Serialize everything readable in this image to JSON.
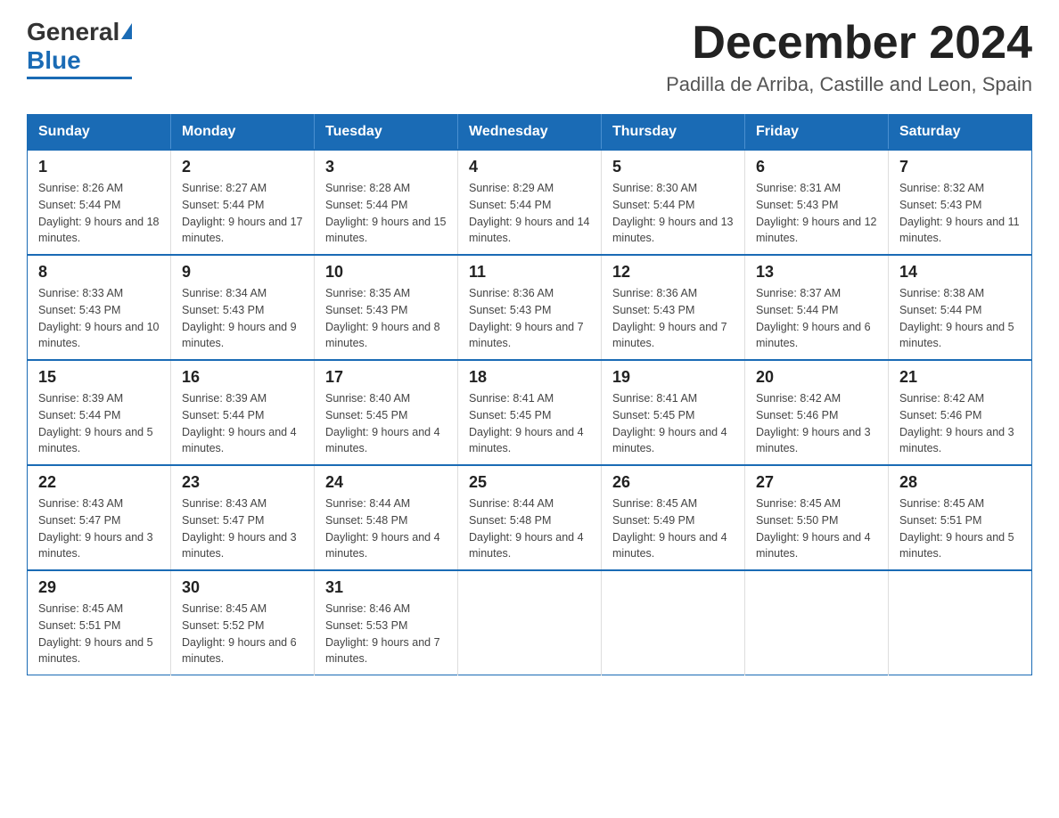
{
  "header": {
    "logo": {
      "general": "General",
      "blue": "Blue"
    },
    "title": "December 2024",
    "location": "Padilla de Arriba, Castille and Leon, Spain"
  },
  "days_of_week": [
    "Sunday",
    "Monday",
    "Tuesday",
    "Wednesday",
    "Thursday",
    "Friday",
    "Saturday"
  ],
  "weeks": [
    [
      {
        "day": "1",
        "sunrise": "Sunrise: 8:26 AM",
        "sunset": "Sunset: 5:44 PM",
        "daylight": "Daylight: 9 hours and 18 minutes."
      },
      {
        "day": "2",
        "sunrise": "Sunrise: 8:27 AM",
        "sunset": "Sunset: 5:44 PM",
        "daylight": "Daylight: 9 hours and 17 minutes."
      },
      {
        "day": "3",
        "sunrise": "Sunrise: 8:28 AM",
        "sunset": "Sunset: 5:44 PM",
        "daylight": "Daylight: 9 hours and 15 minutes."
      },
      {
        "day": "4",
        "sunrise": "Sunrise: 8:29 AM",
        "sunset": "Sunset: 5:44 PM",
        "daylight": "Daylight: 9 hours and 14 minutes."
      },
      {
        "day": "5",
        "sunrise": "Sunrise: 8:30 AM",
        "sunset": "Sunset: 5:44 PM",
        "daylight": "Daylight: 9 hours and 13 minutes."
      },
      {
        "day": "6",
        "sunrise": "Sunrise: 8:31 AM",
        "sunset": "Sunset: 5:43 PM",
        "daylight": "Daylight: 9 hours and 12 minutes."
      },
      {
        "day": "7",
        "sunrise": "Sunrise: 8:32 AM",
        "sunset": "Sunset: 5:43 PM",
        "daylight": "Daylight: 9 hours and 11 minutes."
      }
    ],
    [
      {
        "day": "8",
        "sunrise": "Sunrise: 8:33 AM",
        "sunset": "Sunset: 5:43 PM",
        "daylight": "Daylight: 9 hours and 10 minutes."
      },
      {
        "day": "9",
        "sunrise": "Sunrise: 8:34 AM",
        "sunset": "Sunset: 5:43 PM",
        "daylight": "Daylight: 9 hours and 9 minutes."
      },
      {
        "day": "10",
        "sunrise": "Sunrise: 8:35 AM",
        "sunset": "Sunset: 5:43 PM",
        "daylight": "Daylight: 9 hours and 8 minutes."
      },
      {
        "day": "11",
        "sunrise": "Sunrise: 8:36 AM",
        "sunset": "Sunset: 5:43 PM",
        "daylight": "Daylight: 9 hours and 7 minutes."
      },
      {
        "day": "12",
        "sunrise": "Sunrise: 8:36 AM",
        "sunset": "Sunset: 5:43 PM",
        "daylight": "Daylight: 9 hours and 7 minutes."
      },
      {
        "day": "13",
        "sunrise": "Sunrise: 8:37 AM",
        "sunset": "Sunset: 5:44 PM",
        "daylight": "Daylight: 9 hours and 6 minutes."
      },
      {
        "day": "14",
        "sunrise": "Sunrise: 8:38 AM",
        "sunset": "Sunset: 5:44 PM",
        "daylight": "Daylight: 9 hours and 5 minutes."
      }
    ],
    [
      {
        "day": "15",
        "sunrise": "Sunrise: 8:39 AM",
        "sunset": "Sunset: 5:44 PM",
        "daylight": "Daylight: 9 hours and 5 minutes."
      },
      {
        "day": "16",
        "sunrise": "Sunrise: 8:39 AM",
        "sunset": "Sunset: 5:44 PM",
        "daylight": "Daylight: 9 hours and 4 minutes."
      },
      {
        "day": "17",
        "sunrise": "Sunrise: 8:40 AM",
        "sunset": "Sunset: 5:45 PM",
        "daylight": "Daylight: 9 hours and 4 minutes."
      },
      {
        "day": "18",
        "sunrise": "Sunrise: 8:41 AM",
        "sunset": "Sunset: 5:45 PM",
        "daylight": "Daylight: 9 hours and 4 minutes."
      },
      {
        "day": "19",
        "sunrise": "Sunrise: 8:41 AM",
        "sunset": "Sunset: 5:45 PM",
        "daylight": "Daylight: 9 hours and 4 minutes."
      },
      {
        "day": "20",
        "sunrise": "Sunrise: 8:42 AM",
        "sunset": "Sunset: 5:46 PM",
        "daylight": "Daylight: 9 hours and 3 minutes."
      },
      {
        "day": "21",
        "sunrise": "Sunrise: 8:42 AM",
        "sunset": "Sunset: 5:46 PM",
        "daylight": "Daylight: 9 hours and 3 minutes."
      }
    ],
    [
      {
        "day": "22",
        "sunrise": "Sunrise: 8:43 AM",
        "sunset": "Sunset: 5:47 PM",
        "daylight": "Daylight: 9 hours and 3 minutes."
      },
      {
        "day": "23",
        "sunrise": "Sunrise: 8:43 AM",
        "sunset": "Sunset: 5:47 PM",
        "daylight": "Daylight: 9 hours and 3 minutes."
      },
      {
        "day": "24",
        "sunrise": "Sunrise: 8:44 AM",
        "sunset": "Sunset: 5:48 PM",
        "daylight": "Daylight: 9 hours and 4 minutes."
      },
      {
        "day": "25",
        "sunrise": "Sunrise: 8:44 AM",
        "sunset": "Sunset: 5:48 PM",
        "daylight": "Daylight: 9 hours and 4 minutes."
      },
      {
        "day": "26",
        "sunrise": "Sunrise: 8:45 AM",
        "sunset": "Sunset: 5:49 PM",
        "daylight": "Daylight: 9 hours and 4 minutes."
      },
      {
        "day": "27",
        "sunrise": "Sunrise: 8:45 AM",
        "sunset": "Sunset: 5:50 PM",
        "daylight": "Daylight: 9 hours and 4 minutes."
      },
      {
        "day": "28",
        "sunrise": "Sunrise: 8:45 AM",
        "sunset": "Sunset: 5:51 PM",
        "daylight": "Daylight: 9 hours and 5 minutes."
      }
    ],
    [
      {
        "day": "29",
        "sunrise": "Sunrise: 8:45 AM",
        "sunset": "Sunset: 5:51 PM",
        "daylight": "Daylight: 9 hours and 5 minutes."
      },
      {
        "day": "30",
        "sunrise": "Sunrise: 8:45 AM",
        "sunset": "Sunset: 5:52 PM",
        "daylight": "Daylight: 9 hours and 6 minutes."
      },
      {
        "day": "31",
        "sunrise": "Sunrise: 8:46 AM",
        "sunset": "Sunset: 5:53 PM",
        "daylight": "Daylight: 9 hours and 7 minutes."
      },
      null,
      null,
      null,
      null
    ]
  ]
}
